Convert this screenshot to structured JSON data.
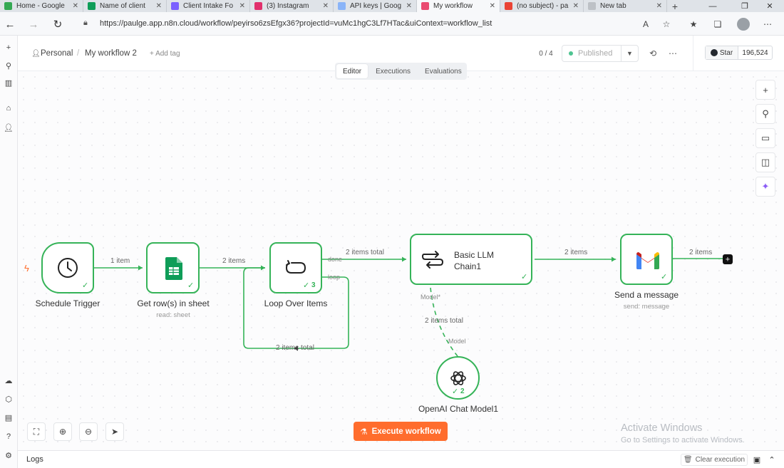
{
  "browser": {
    "tabs": [
      {
        "label": "Home - Google",
        "color": "#34a853",
        "active": false
      },
      {
        "label": "Name of client",
        "color": "#0f9d58",
        "active": false
      },
      {
        "label": "Client Intake Fo",
        "color": "#7b61ff",
        "active": false
      },
      {
        "label": "(3) Instagram",
        "color": "#e1306c",
        "active": false
      },
      {
        "label": "API keys | Goog",
        "color": "#8ab4f8",
        "active": false
      },
      {
        "label": "My workflow",
        "color": "#ea4b71",
        "active": true
      },
      {
        "label": "(no subject) - pa",
        "color": "#ea4335",
        "active": false
      },
      {
        "label": "New tab",
        "color": "#bdc1c6",
        "active": false
      }
    ],
    "url": "https://paulge.app.n8n.cloud/workflow/peyirso6zsEfgx36?projectId=vuMc1hgC3Lf7HTac&uiContext=workflow_list"
  },
  "header": {
    "project": "Personal",
    "workflow_name": "My workflow 2",
    "add_tag": "+ Add tag",
    "counter": "0 / 4",
    "publish_label": "Published",
    "github": {
      "star_label": "Star",
      "star_count": "196,524"
    }
  },
  "view_tabs": [
    "Editor",
    "Executions",
    "Evaluations"
  ],
  "nodes": {
    "schedule": {
      "label": "Schedule Trigger"
    },
    "sheet": {
      "label": "Get row(s) in sheet",
      "subtitle": "read: sheet"
    },
    "loop": {
      "label": "Loop Over Items",
      "count": "3",
      "port_done": "done",
      "port_loop": "loop"
    },
    "llm": {
      "label": "Basic LLM Chain1",
      "label_line1": "Basic LLM",
      "label_line2": "Chain1",
      "port_model": "Model*"
    },
    "gmail": {
      "label": "Send a message",
      "subtitle": "send: message"
    },
    "openai": {
      "label": "OpenAI Chat Model1",
      "count": "2",
      "port_model": "Model"
    }
  },
  "edges": {
    "trigger_to_sheet": "1 item",
    "sheet_to_loop": "2 items",
    "loop_done_to_llm": "2 items total",
    "llm_to_gmail": "2 items",
    "gmail_out": "2 items",
    "loop_back": "2 items total",
    "model_link": "2 items total"
  },
  "execute_label": "Execute workflow",
  "watermark": {
    "title": "Activate Windows",
    "subtitle": "Go to Settings to activate Windows."
  },
  "logs": {
    "label": "Logs",
    "clear_label": "Clear execution"
  },
  "colors": {
    "success": "#35b358",
    "accent": "#ff6d2d"
  }
}
